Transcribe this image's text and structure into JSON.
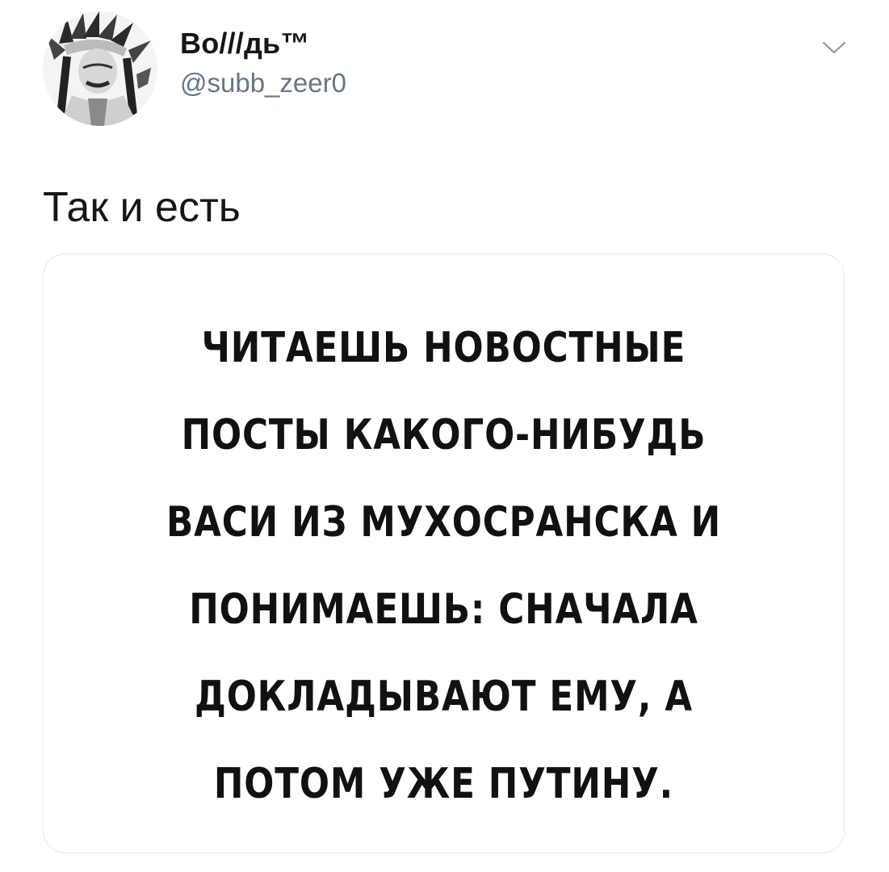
{
  "tweet": {
    "author": {
      "display_name": "Во///дь™",
      "handle": "@subb_zeer0",
      "avatar_icon": "avatar-portrait"
    },
    "menu_icon": "chevron-down-icon",
    "text": "Так и есть",
    "media": {
      "lines": [
        "ЧИТАЕШЬ НОВОСТНЫЕ",
        "ПОСТЫ КАКОГО-НИБУДЬ",
        "ВАСИ ИЗ МУХОСРАНСКА И",
        "ПОНИМАЕШЬ: СНАЧАЛА",
        "ДОКЛАДЫВАЮТ ЕМУ, А",
        "ПОТОМ УЖЕ ПУТИНУ."
      ]
    }
  },
  "colors": {
    "text_primary": "#14171a",
    "text_secondary": "#657786",
    "border": "#e1e8ed"
  }
}
